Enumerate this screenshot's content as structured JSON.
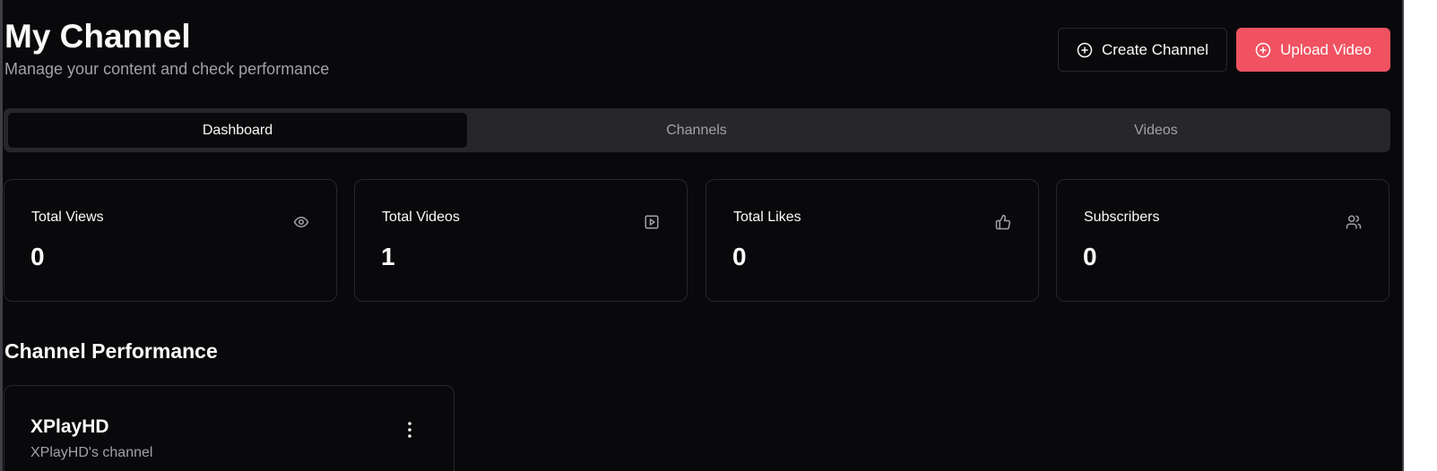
{
  "header": {
    "title": "My Channel",
    "subtitle": "Manage your content and check performance",
    "create_channel_label": "Create Channel",
    "upload_video_label": "Upload Video"
  },
  "icons": {
    "create_channel": "plus-circle-icon",
    "upload_video": "plus-circle-icon",
    "total_views": "eye-icon",
    "total_videos": "play-square-icon",
    "total_likes": "thumbs-up-icon",
    "subscribers": "users-icon",
    "channel_menu": "more-vertical-icon"
  },
  "colors": {
    "background": "#09090b",
    "accent": "#f05261",
    "muted_text": "#a1a1aa",
    "border": "#27272a"
  },
  "tabs": [
    {
      "label": "Dashboard",
      "active": true
    },
    {
      "label": "Channels",
      "active": false
    },
    {
      "label": "Videos",
      "active": false
    }
  ],
  "stats": [
    {
      "label": "Total Views",
      "value": "0"
    },
    {
      "label": "Total Videos",
      "value": "1"
    },
    {
      "label": "Total Likes",
      "value": "0"
    },
    {
      "label": "Subscribers",
      "value": "0"
    }
  ],
  "performance": {
    "title": "Channel Performance",
    "channels": [
      {
        "name": "XPlayHD",
        "description": "XPlayHD's channel"
      }
    ]
  }
}
